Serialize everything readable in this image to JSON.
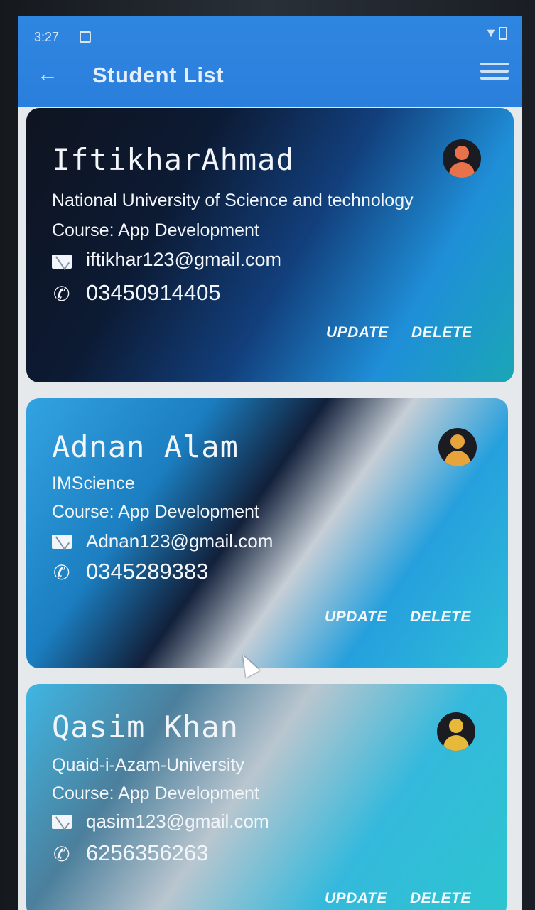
{
  "status_bar": {
    "time": "3:27"
  },
  "app_bar": {
    "title": "Student List"
  },
  "students": [
    {
      "name": "IftikharAhmad",
      "university": "National University of Science and technology",
      "course": "Course: App Development",
      "email": "iftikhar123@gmail.com",
      "phone": "03450914405",
      "avatar_color": "#e8734a"
    },
    {
      "name": "Adnan Alam",
      "university": "IMScience",
      "course": "Course: App Development",
      "email": "Adnan123@gmail.com",
      "phone": "0345289383",
      "avatar_color": "#e7a43a"
    },
    {
      "name": "Qasim Khan",
      "university": "Quaid-i-Azam-University",
      "course": "Course: App Development",
      "email": "qasim123@gmail.com",
      "phone": "6256356263",
      "avatar_color": "#e6b93a"
    }
  ],
  "actions": {
    "update_label": "UPDATE",
    "delete_label": "DELETE"
  },
  "icons": {
    "back": "arrow-left-icon",
    "menu": "list-menu-icon",
    "email": "email-icon",
    "phone": "phone-icon",
    "avatar": "person-avatar-icon"
  }
}
